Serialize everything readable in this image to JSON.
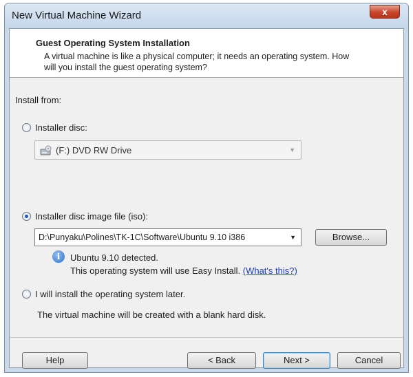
{
  "window": {
    "title": "New Virtual Machine Wizard",
    "close_label": "x"
  },
  "header": {
    "title": "Guest Operating System Installation",
    "description": "A virtual machine is like a physical computer; it needs an operating system. How will you install the guest operating system?"
  },
  "install_from": {
    "label": "Install from:",
    "installer_disc": {
      "label": "Installer disc:",
      "selected": false,
      "drive_value": "(F:) DVD RW Drive",
      "drive_icon": "dvd-drive-icon"
    },
    "iso_image": {
      "label": "Installer disc image file (iso):",
      "selected": true,
      "path_value": "D:\\Punyaku\\Polines\\TK-1C\\Software\\Ubuntu 9.10 i386",
      "browse_label": "Browse...",
      "detected_text": "Ubuntu 9.10 detected.",
      "easy_install_text": "This operating system will use Easy Install.",
      "whats_this_link": "(What's this?)",
      "info_icon": "info-icon"
    },
    "install_later": {
      "label": "I will install the operating system later.",
      "selected": false,
      "note": "The virtual machine will be created with a blank hard disk."
    }
  },
  "footer": {
    "help_label": "Help",
    "back_label": "< Back",
    "next_label": "Next >",
    "cancel_label": "Cancel"
  },
  "colors": {
    "title_bar": "#c9d9ea",
    "dialog_bg": "#f0f0f0",
    "close_button": "#c8452c",
    "link": "#1a43c2",
    "default_button_border": "#3c7fb1"
  }
}
